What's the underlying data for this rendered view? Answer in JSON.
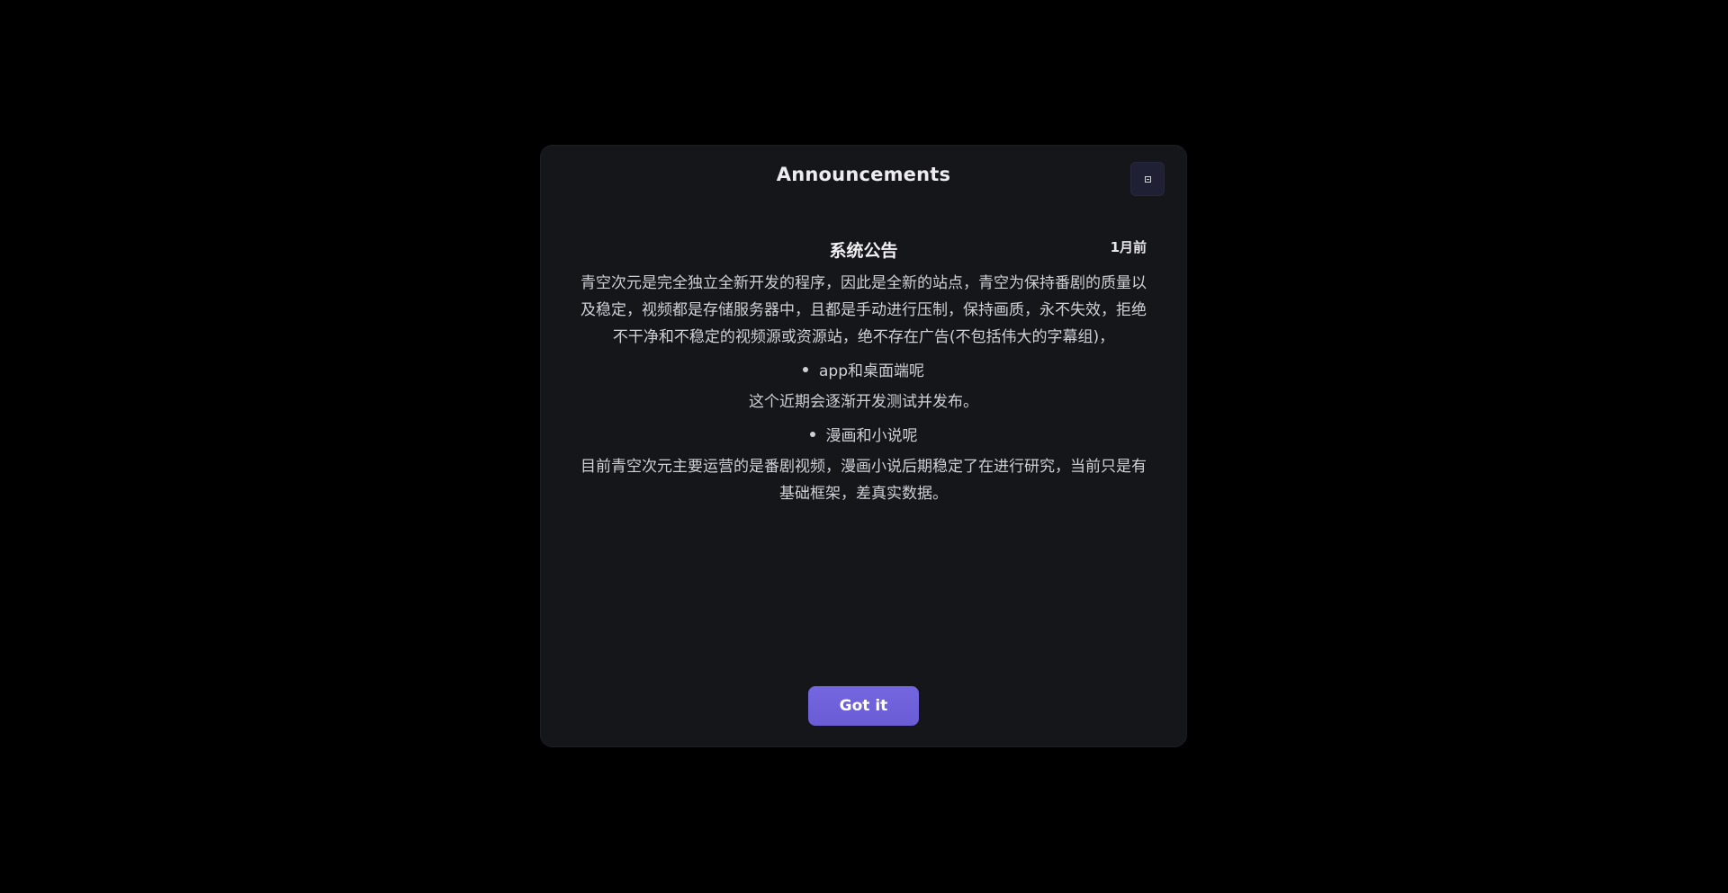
{
  "modal": {
    "title": "Announcements",
    "close_icon": "close-icon",
    "primary_button_label": "Got it"
  },
  "notice": {
    "title": "系统公告",
    "time": "1月前",
    "paragraph_1": "青空次元是完全独立全新开发的程序，因此是全新的站点，青空为保持番剧的质量以及稳定，视频都是存储服务器中，且都是手动进行压制，保持画质，永不失效，拒绝不干净和不稳定的视频源或资源站，绝不存在广告(不包括伟大的字幕组)，",
    "bullet_1": "app和桌面端呢",
    "paragraph_2": "这个近期会逐渐开发测试并发布。",
    "bullet_2": "漫画和小说呢",
    "paragraph_3": "目前青空次元主要运营的是番剧视频，漫画小说后期稳定了在进行研究，当前只是有基础框架，差真实数据。"
  },
  "colors": {
    "background": "#000000",
    "modal_background": "#15161a",
    "accent": "#6d5fd6",
    "close_button_background": "#1f2033"
  }
}
